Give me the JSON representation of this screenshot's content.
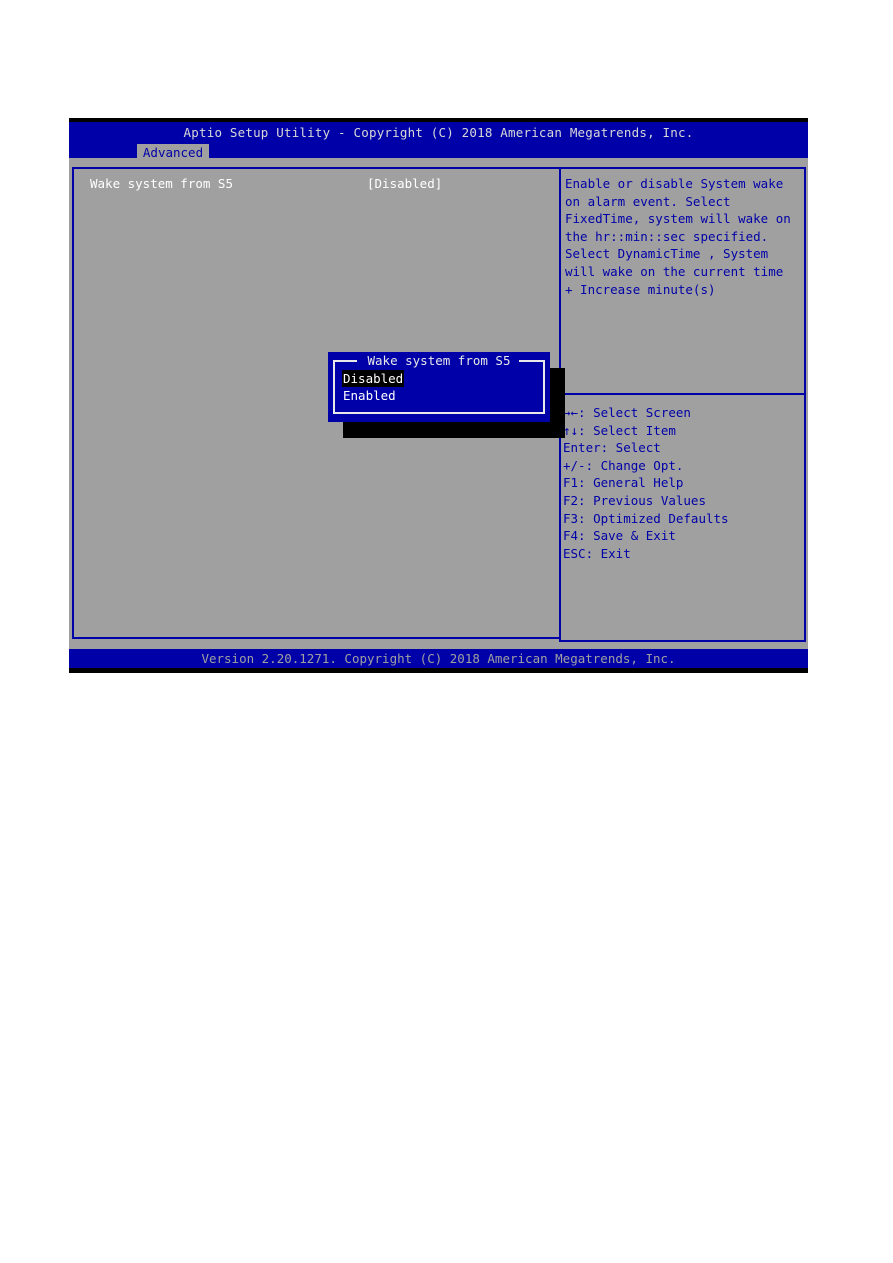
{
  "header": {
    "title": "Aptio Setup Utility - Copyright (C) 2018 American Megatrends, Inc.",
    "active_tab": "Advanced"
  },
  "settings": [
    {
      "label": "Wake system from S5",
      "value": "[Disabled]"
    }
  ],
  "help": {
    "lines": [
      "Enable or disable System wake",
      "on alarm event. Select",
      "FixedTime, system will wake on",
      "the hr::min::sec specified.",
      "Select DynamicTime , System",
      "will wake on the current time",
      "+ Increase minute(s)"
    ]
  },
  "keys": [
    "→←: Select Screen",
    "↑↓: Select Item",
    "Enter: Select",
    "+/-: Change Opt.",
    "F1: General Help",
    "F2: Previous Values",
    "F3: Optimized Defaults",
    "F4: Save & Exit",
    "ESC: Exit"
  ],
  "popup": {
    "title": " Wake system from S5 ",
    "options": [
      {
        "label": "Disabled",
        "selected": true
      },
      {
        "label": "Enabled",
        "selected": false
      }
    ]
  },
  "footer": {
    "text": "Version 2.20.1271. Copyright (C) 2018 American Megatrends, Inc."
  },
  "colors": {
    "bios_blue": "#0000a8",
    "bios_gray": "#a0a0a0",
    "highlight_black": "#000000",
    "text_white": "#ffffff"
  }
}
